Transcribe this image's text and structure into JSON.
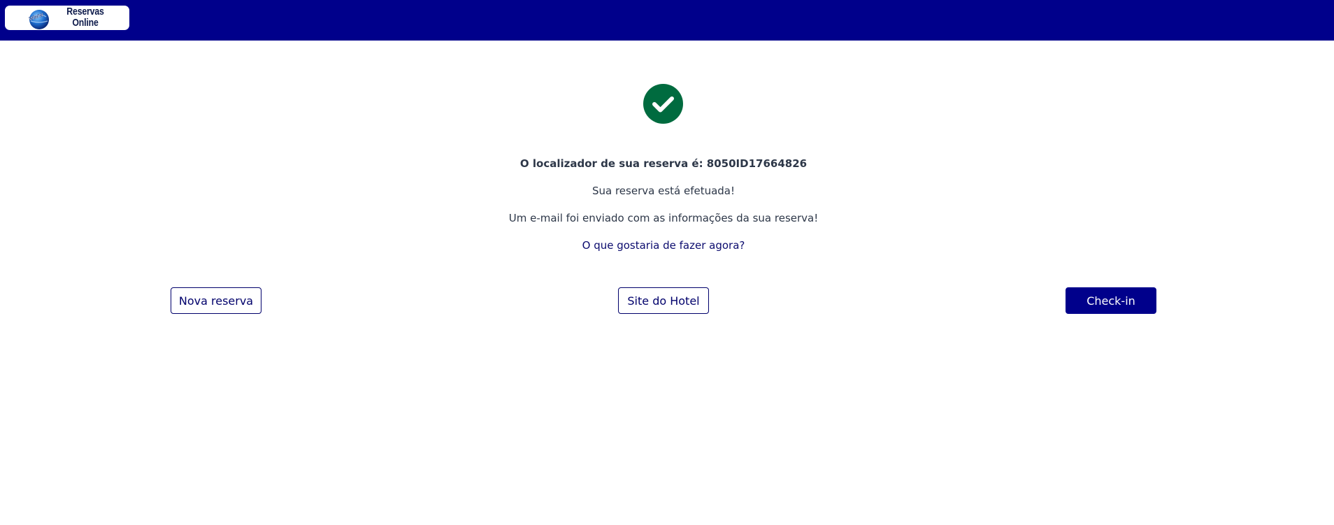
{
  "header": {
    "logo_line1": "Reservas",
    "logo_line2": "Online",
    "logo_icon": "www-globe-icon",
    "background_color": "#00008b"
  },
  "confirmation": {
    "icon": "check-circle-icon",
    "icon_color": "#006b3f",
    "locator_text": "O localizador de sua reserva é: 8050ID17664826",
    "status_text": "Sua reserva está efetuada!",
    "email_text": "Um e-mail foi enviado com as informações da sua reserva!",
    "question_text": "O que gostaria de fazer agora?"
  },
  "actions": {
    "new_reservation_label": "Nova reserva",
    "hotel_site_label": "Site do Hotel",
    "checkin_label": "Check-in",
    "primary_color": "#00008b"
  }
}
